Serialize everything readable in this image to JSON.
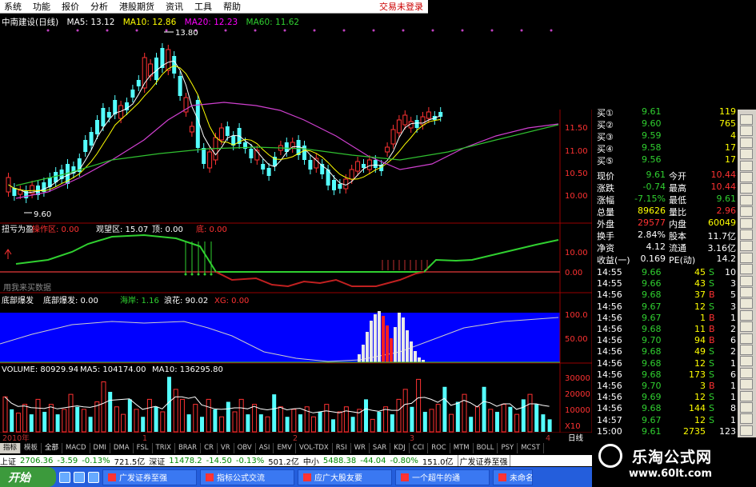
{
  "menu": [
    "系统",
    "功能",
    "报价",
    "分析",
    "港股期货",
    "资讯",
    "工具",
    "帮助"
  ],
  "trade_status": "交易未登录",
  "main_chart": {
    "stock_title": "中南建设(日线)",
    "ma5": "MA5: 13.12",
    "ma10": "MA10: 12.86",
    "ma20": "MA20: 12.23",
    "ma60": "MA60: 11.62",
    "high_label": "13.80",
    "low_label": "9.60",
    "y_ticks": [
      "11.50",
      "11.00",
      "10.50",
      "10.00"
    ]
  },
  "indicator1": {
    "name": "扭亏为盈",
    "op_label": "操作区: 0.00",
    "watch_label": "观望区: 15.07",
    "item_label": "顶: 0.00",
    "bottom_label": "底: 0.00",
    "watermark_text": "用我来买数据",
    "y_ticks": [
      "10.00",
      "0.00"
    ]
  },
  "indicator2": {
    "name": "底部爆发",
    "field1": "底部爆发: 0.00",
    "field2": "海岸: 1.16",
    "field3": "浪花: 90.02",
    "field4": "XG: 0.00",
    "y_ticks": [
      "100.0",
      "50.00"
    ]
  },
  "volume": {
    "label": "VOLUME: 80929.94",
    "ma5": "MA5: 104174.00",
    "ma10": "MA10: 136295.80",
    "y_ticks": [
      "30000",
      "20000",
      "10000",
      "X10"
    ],
    "values": [
      28,
      18,
      15,
      22,
      14,
      26,
      16,
      22,
      14,
      18,
      30,
      20,
      18,
      12,
      24,
      40,
      32,
      20,
      14,
      26,
      18,
      12,
      26,
      20,
      16,
      44,
      34,
      26,
      14,
      22,
      12,
      26,
      18,
      12,
      24,
      16,
      26,
      14,
      22,
      14,
      12,
      30,
      20,
      12,
      18,
      14,
      20,
      12,
      16,
      22,
      10,
      16,
      20,
      12,
      18,
      26,
      10,
      16,
      20,
      14,
      26,
      34,
      20,
      42,
      16,
      18,
      22,
      36,
      14,
      24,
      30,
      12,
      20,
      36,
      18,
      16,
      22,
      20,
      14,
      26,
      30,
      22,
      14,
      10
    ],
    "colors": "rcrrcrcrcrrcrcrrcrrcrcrcrcrrcrcrcrcrrcrcrcrcrcrrcrcrrcrcrcrcrrcrcrrcrcrcrcrcrcrcrc"
  },
  "x_axis": {
    "year": "2010年",
    "m1": "1",
    "m2": "2",
    "m3": "3",
    "m4": "4",
    "label": "日线"
  },
  "quote": {
    "buy": [
      {
        "label": "买①",
        "price": "9.61",
        "vol": "119"
      },
      {
        "label": "买②",
        "price": "9.60",
        "vol": "765"
      },
      {
        "label": "买③",
        "price": "9.59",
        "vol": "4"
      },
      {
        "label": "买④",
        "price": "9.58",
        "vol": "17"
      },
      {
        "label": "买⑤",
        "price": "9.56",
        "vol": "17"
      }
    ],
    "stats": [
      {
        "l1": "现价",
        "v1": "9.61",
        "l2": "今开",
        "v2": "10.44"
      },
      {
        "l1": "涨跌",
        "v1": "-0.74",
        "l2": "最高",
        "v2": "10.44"
      },
      {
        "l1": "涨幅",
        "v1": "-7.15%",
        "l2": "最低",
        "v2": "9.61"
      },
      {
        "l1": "总量",
        "v1": "89626",
        "l2": "量比",
        "v2": "2.96"
      },
      {
        "l1": "外盘",
        "v1": "29577",
        "l2": "内盘",
        "v2": "60049"
      },
      {
        "l1": "换手",
        "v1": "2.84%",
        "l2": "股本",
        "v2": "11.7亿"
      },
      {
        "l1": "净资",
        "v1": "4.12",
        "l2": "流通",
        "v2": "3.16亿"
      },
      {
        "l1": "收益(一)",
        "v1": "0.169",
        "l2": "PE(动)",
        "v2": "14.2"
      }
    ],
    "ticks": [
      {
        "t": "14:55",
        "p": "9.66",
        "v": "45",
        "d": "S",
        "n": "10"
      },
      {
        "t": "14:55",
        "p": "9.66",
        "v": "43",
        "d": "S",
        "n": "3"
      },
      {
        "t": "14:56",
        "p": "9.68",
        "v": "37",
        "d": "B",
        "n": "5"
      },
      {
        "t": "14:56",
        "p": "9.67",
        "v": "12",
        "d": "S",
        "n": "3"
      },
      {
        "t": "14:56",
        "p": "9.67",
        "v": "1",
        "d": "B",
        "n": "1"
      },
      {
        "t": "14:56",
        "p": "9.68",
        "v": "11",
        "d": "B",
        "n": "2"
      },
      {
        "t": "14:56",
        "p": "9.70",
        "v": "94",
        "d": "B",
        "n": "6"
      },
      {
        "t": "14:56",
        "p": "9.68",
        "v": "49",
        "d": "S",
        "n": "2"
      },
      {
        "t": "14:56",
        "p": "9.68",
        "v": "12",
        "d": "S",
        "n": "1"
      },
      {
        "t": "14:56",
        "p": "9.68",
        "v": "173",
        "d": "S",
        "n": "6"
      },
      {
        "t": "14:56",
        "p": "9.70",
        "v": "3",
        "d": "B",
        "n": "1"
      },
      {
        "t": "14:56",
        "p": "9.69",
        "v": "12",
        "d": "S",
        "n": "1"
      },
      {
        "t": "14:56",
        "p": "9.68",
        "v": "144",
        "d": "S",
        "n": "8"
      },
      {
        "t": "14:57",
        "p": "9.67",
        "v": "12",
        "d": "S",
        "n": "1"
      },
      {
        "t": "15:00",
        "p": "9.61",
        "v": "2735",
        "d": "",
        "n": "123"
      }
    ]
  },
  "tabs": [
    "指标",
    "模板",
    "全部",
    "MACD",
    "DMI",
    "DMA",
    "FSL",
    "TRIX",
    "BRAR",
    "CR",
    "VR",
    "OBV",
    "ASI",
    "EMV",
    "VOL-TDX",
    "RSI",
    "WR",
    "SAR",
    "KDJ",
    "CCI",
    "ROC",
    "MTM",
    "BOLL",
    "PSY",
    "MCST"
  ],
  "index_bar": {
    "sh_label": "上证",
    "sh_val": "2706.36",
    "sh_chg": "-3.59",
    "sh_pct": "-0.13%",
    "sh_amt": "721.5亿",
    "sz_label": "深证",
    "sz_val": "11478.2",
    "sz_chg": "-14.50",
    "sz_pct": "-0.13%",
    "sz_amt": "501.2亿",
    "zx_label": "中小",
    "zx_val": "5488.38",
    "zx_chg": "-44.04",
    "zx_pct": "-0.80%",
    "zx_amt": "151.0亿",
    "broker": "广发证券至强"
  },
  "taskbar": {
    "start": "开始",
    "tasks": [
      "广发证券至强",
      "指标公式交流",
      "应广大股友要",
      "一个超牛的通",
      "未命名"
    ]
  },
  "site_watermark": {
    "title": "乐淘公式网",
    "url": "www.60lt.com"
  },
  "colors": {
    "up": "#ff3232",
    "down": "#54ffff",
    "ma5": "#ffffff",
    "ma10": "#ffff00",
    "ma20": "#ff00ff",
    "ma60": "#00ff00"
  }
}
